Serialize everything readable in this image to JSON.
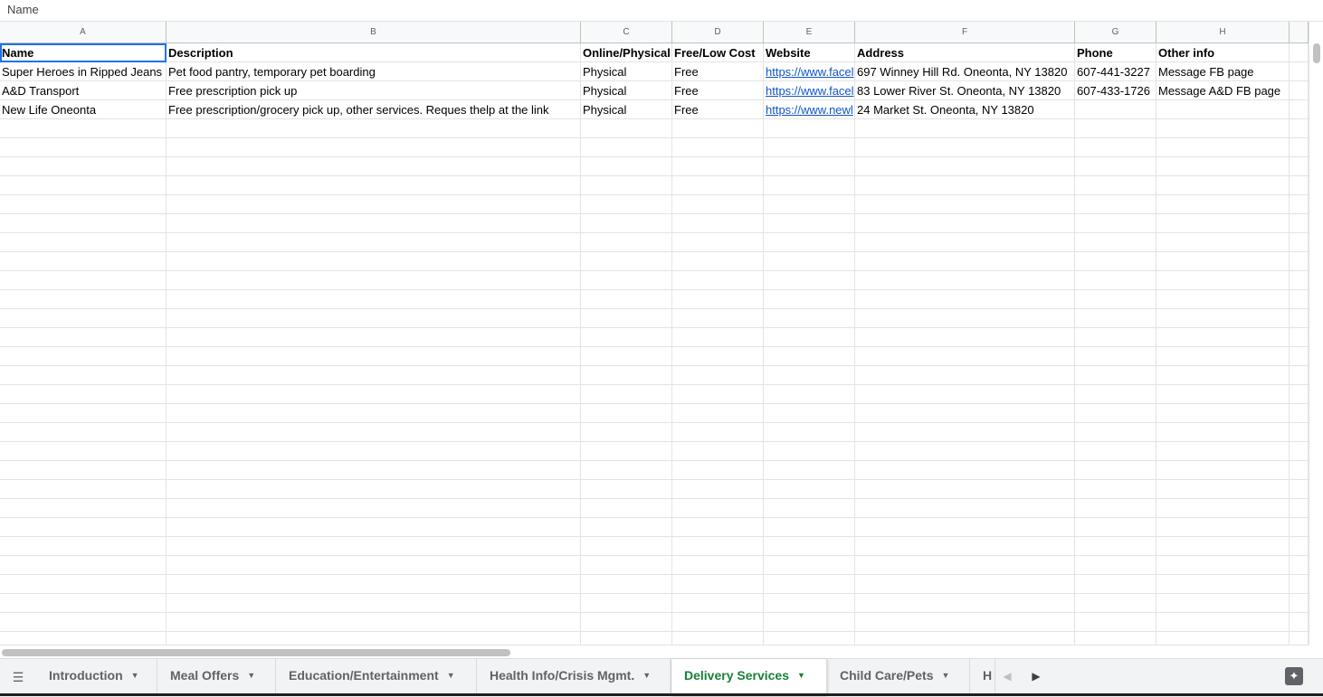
{
  "namebar": {
    "label": "Name"
  },
  "columns": [
    "A",
    "B",
    "C",
    "D",
    "E",
    "F",
    "G",
    "H"
  ],
  "header_row": [
    "Name",
    "Description",
    "Online/Physical",
    "Free/Low Cost",
    "Website",
    "Address",
    "Phone",
    "Other info"
  ],
  "rows": [
    [
      "Super Heroes in Ripped Jeans",
      "Pet food pantry, temporary pet boarding",
      "Physical",
      "Free",
      "https://www.facel",
      "697 Winney Hill Rd. Oneonta, NY 13820",
      "607-441-3227",
      "Message FB page"
    ],
    [
      "A&D Transport",
      "Free prescription pick up",
      "Physical",
      "Free",
      "https://www.facel",
      "83 Lower River St. Oneonta, NY 13820",
      "607-433-1726",
      "Message A&D FB page"
    ],
    [
      "New Life Oneonta",
      "Free prescription/grocery pick up, other services. Reques thelp at the link",
      "Physical",
      "Free",
      "https://www.newl",
      "24 Market St. Oneonta, NY 13820",
      "",
      ""
    ]
  ],
  "sheet_tabs": [
    {
      "label": "Introduction",
      "active": false
    },
    {
      "label": "Meal Offers",
      "active": false
    },
    {
      "label": "Education/Entertainment",
      "active": false
    },
    {
      "label": "Health Info/Crisis Mgmt.",
      "active": false
    },
    {
      "label": "Delivery Services",
      "active": true
    },
    {
      "label": "Child Care/Pets",
      "active": false
    },
    {
      "label": "H",
      "active": false
    }
  ],
  "icons": {
    "all_sheets": "menu-lines-icon",
    "tab_caret": "caret-down-icon",
    "scroll_left": "chevron-left-icon",
    "scroll_right": "chevron-right-icon",
    "explore": "explore-sparkle-icon"
  },
  "colors": {
    "active_tab": "#188038",
    "link": "#1155cc",
    "selection": "#1a73e8"
  }
}
